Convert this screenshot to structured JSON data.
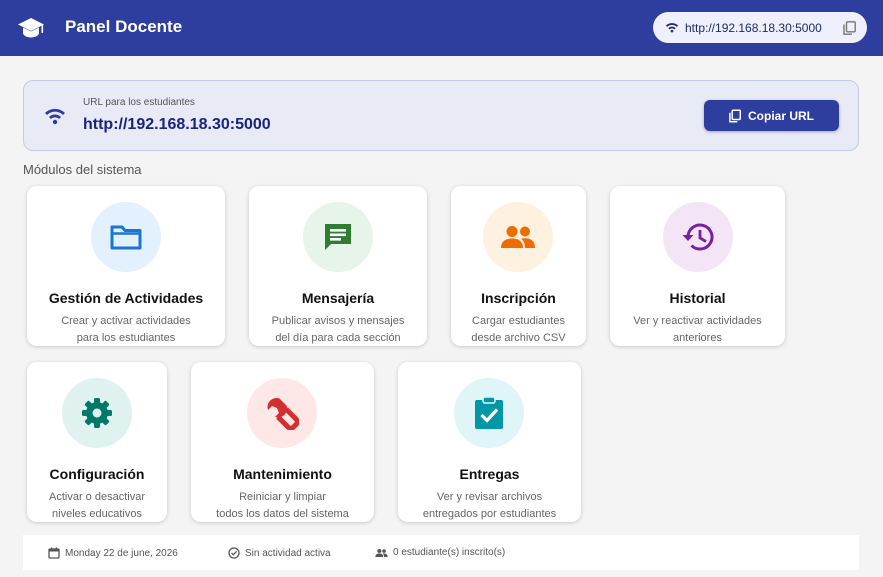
{
  "appbar": {
    "title": "Panel Docente",
    "url": "http://192.168.18.30:5000",
    "icons": {
      "logo": "graduation-cap-icon",
      "wifi": "wifi-icon",
      "copy": "copy-icon"
    }
  },
  "url_card": {
    "label": "URL para los estudiantes",
    "url": "http://192.168.18.30:5000",
    "copy_button": "Copiar URL"
  },
  "section_title": "Módulos del sistema",
  "modules": [
    {
      "title": "Gestión de Actividades",
      "desc1": "Crear y activar actividades",
      "desc2": "para los estudiantes",
      "icon": "folder-icon",
      "color": "#1976d2",
      "bg": "#e3f0fd"
    },
    {
      "title": "Mensajería",
      "desc1": "Publicar avisos y mensajes",
      "desc2": "del día para cada sección",
      "icon": "chat-icon",
      "color": "#2e7d32",
      "bg": "#e6f4ea"
    },
    {
      "title": "Inscripción",
      "desc1": "Cargar estudiantes",
      "desc2": "desde archivo CSV",
      "icon": "people-icon",
      "color": "#ef6c00",
      "bg": "#fff1e0"
    },
    {
      "title": "Historial",
      "desc1": "Ver y reactivar actividades",
      "desc2": "anteriores",
      "icon": "history-icon",
      "color": "#7b1fa2",
      "bg": "#f3e5f5"
    },
    {
      "title": "Configuración",
      "desc1": "Activar o desactivar",
      "desc2": "niveles educativos",
      "icon": "gear-icon",
      "color": "#00796b",
      "bg": "#e0f2ef"
    },
    {
      "title": "Mantenimiento",
      "desc1": "Reiniciar y limpiar",
      "desc2": "todos los datos del sistema",
      "icon": "wrench-icon",
      "color": "#d32f2f",
      "bg": "#fde7e7"
    },
    {
      "title": "Entregas",
      "desc1": "Ver y revisar archivos",
      "desc2": "entregados por estudiantes",
      "icon": "clipboard-check-icon",
      "color": "#0097a7",
      "bg": "#e0f5f8"
    }
  ],
  "footer": {
    "date": "Monday 22 de june, 2026",
    "activity": "Sin actividad activa",
    "students": "0 estudiante(s) inscrito(s)"
  }
}
